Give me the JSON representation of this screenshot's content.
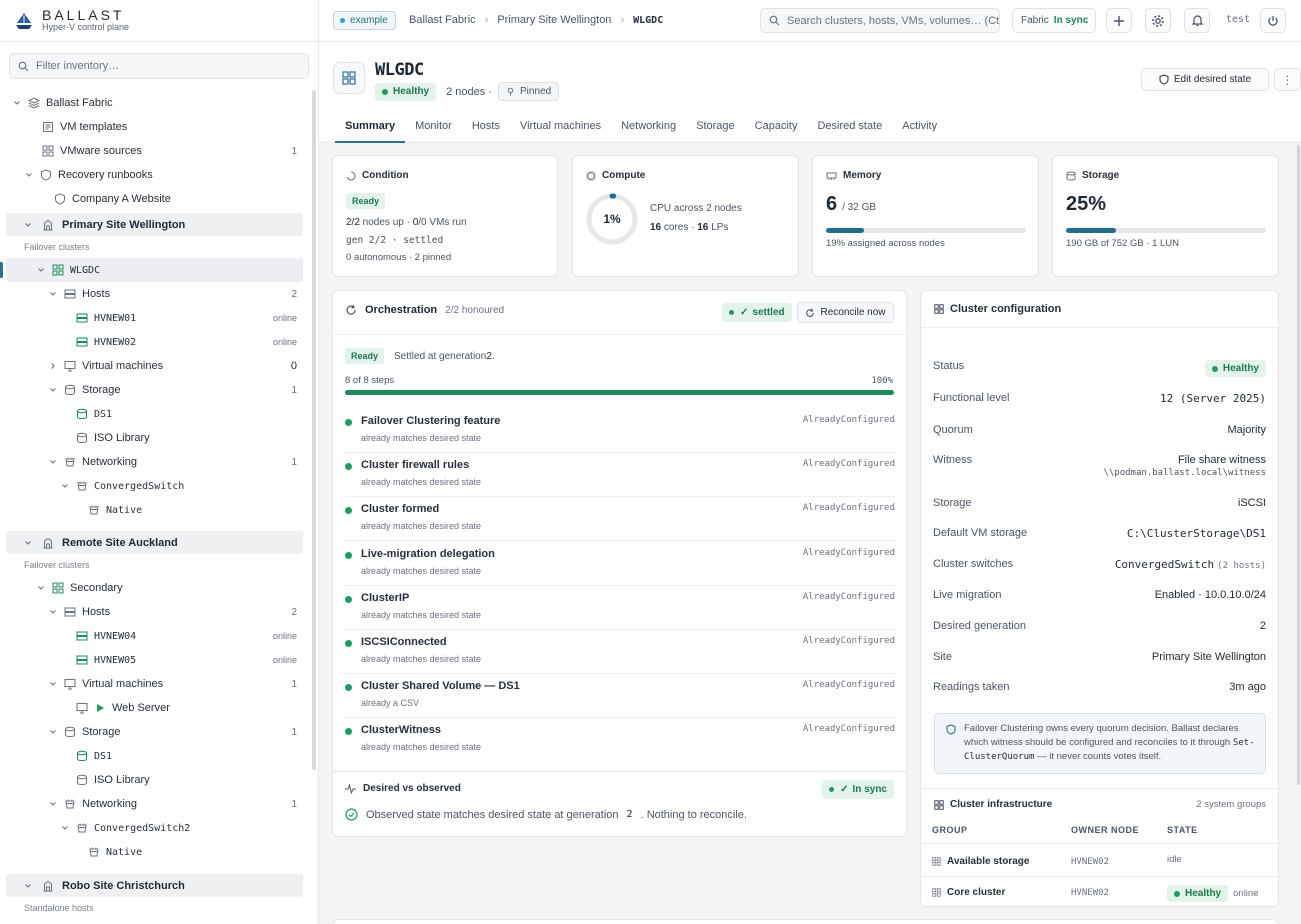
{
  "brand": {
    "name": "BALLAST",
    "subtitle": "Hyper-V control plane"
  },
  "sidebar": {
    "filter_placeholder": "Filter inventory…",
    "tree": {
      "fabric": "Ballast Fabric",
      "vm_templates": "VM templates",
      "vmware_sources": "VMware sources",
      "vmware_sources_count": "1",
      "recovery_runbooks": "Recovery runbooks",
      "company_site": "Company A Website"
    },
    "sites": [
      {
        "name": "Primary Site Wellington",
        "group_label": "Failover clusters",
        "cluster": "WLGDC",
        "hosts_label": "Hosts",
        "hosts_count": "2",
        "hosts": [
          {
            "name": "HVNEW01",
            "status": "online"
          },
          {
            "name": "HVNEW02",
            "status": "online"
          }
        ],
        "vms_label": "Virtual machines",
        "vms_count": "0",
        "storage_label": "Storage",
        "storage_count": "1",
        "storage": [
          "DS1",
          "ISO Library"
        ],
        "networking_label": "Networking",
        "networking_count": "1",
        "switch": "ConvergedSwitch",
        "native": "Native"
      },
      {
        "name": "Remote Site Auckland",
        "group_label": "Failover clusters",
        "cluster": "Secondary",
        "hosts_label": "Hosts",
        "hosts_count": "2",
        "hosts": [
          {
            "name": "HVNEW04",
            "status": "online"
          },
          {
            "name": "HVNEW05",
            "status": "online"
          }
        ],
        "vms_label": "Virtual machines",
        "vms_count": "1",
        "vm": "Web Server",
        "storage_label": "Storage",
        "storage_count": "1",
        "storage": [
          "DS1",
          "ISO Library"
        ],
        "networking_label": "Networking",
        "networking_count": "1",
        "switch": "ConvergedSwitch2",
        "native": "Native"
      },
      {
        "name": "Robo Site Christchurch",
        "group_label": "Standalone hosts"
      }
    ]
  },
  "topbar": {
    "env_badge": "example",
    "breadcrumbs": [
      "Ballast Fabric",
      "Primary Site Wellington",
      "WLGDC"
    ],
    "search_placeholder": "Search clusters, hosts, VMs, volumes… (Ctrl-K)",
    "fabric_label": "Fabric",
    "fabric_status": "In sync",
    "user": "test"
  },
  "header": {
    "title": "WLGDC",
    "health": "Healthy",
    "nodes": "2 nodes ·",
    "pinned": "Pinned",
    "edit_button": "Edit desired state",
    "tabs": [
      "Summary",
      "Monitor",
      "Hosts",
      "Virtual machines",
      "Networking",
      "Storage",
      "Capacity",
      "Desired state",
      "Activity"
    ]
  },
  "condition": {
    "title": "Condition",
    "status": "Ready",
    "nodes_up_a": "2/2",
    "nodes_up_b": " nodes up · ",
    "vms_a": "0",
    "vms_b": "/0 VMs run",
    "gen": "gen 2/2 · settled",
    "footer": "0 autonomous · 2 pinned"
  },
  "compute": {
    "title": "Compute",
    "percent": "1%",
    "percent_value": 1,
    "line1": "CPU across 2 nodes",
    "cores": "16",
    "cores_label": " cores · ",
    "lps": "16",
    "lps_label": " LPs"
  },
  "memory": {
    "title": "Memory",
    "value": "6",
    "total": "/ 32 GB",
    "fill_percent": 19,
    "caption": "19% assigned across nodes"
  },
  "storage": {
    "title": "Storage",
    "value": "25%",
    "fill_percent": 25,
    "caption": "190 GB of 752 GB · 1 LUN"
  },
  "orchestration": {
    "title": "Orchestration",
    "honoured": "2/2 honoured",
    "settled": "settled",
    "reconcile_button": "Reconcile now",
    "ready": "Ready",
    "settled_text_a": "Settled at generation ",
    "settled_text_b": "2",
    "settled_text_c": ".",
    "steps_label": "8 of 8 steps",
    "progress_label": "100%",
    "progress_percent": 100,
    "steps": [
      {
        "name": "Failover Clustering feature",
        "desc": "already matches desired state",
        "status": "AlreadyConfigured"
      },
      {
        "name": "Cluster firewall rules",
        "desc": "already matches desired state",
        "status": "AlreadyConfigured"
      },
      {
        "name": "Cluster formed",
        "desc": "already matches desired state",
        "status": "AlreadyConfigured"
      },
      {
        "name": "Live-migration delegation",
        "desc": "already matches desired state",
        "status": "AlreadyConfigured"
      },
      {
        "name": "ClusterIP",
        "desc": "already matches desired state",
        "status": "AlreadyConfigured"
      },
      {
        "name": "ISCSIConnected",
        "desc": "already matches desired state",
        "status": "AlreadyConfigured"
      },
      {
        "name": "Cluster Shared Volume — DS1",
        "desc": "already a CSV",
        "status": "AlreadyConfigured"
      },
      {
        "name": "ClusterWitness",
        "desc": "already matches desired state",
        "status": "AlreadyConfigured"
      }
    ]
  },
  "desired_vs_observed": {
    "title": "Desired vs observed",
    "status": "In sync",
    "text_a": "Observed state matches desired state at generation",
    "generation": "2",
    "text_b": ". Nothing to reconcile."
  },
  "cluster_config": {
    "title": "Cluster configuration",
    "status_label": "Status",
    "status_value": "Healthy",
    "rows": [
      {
        "label": "Functional level",
        "value": "12 (Server 2025)"
      },
      {
        "label": "Quorum",
        "value": "Majority"
      },
      {
        "label": "Witness",
        "value": "File share witness",
        "sub": "\\\\podman.ballast.local\\witness"
      },
      {
        "label": "Storage",
        "value": "iSCSI"
      },
      {
        "label": "Default VM storage",
        "value": "C:\\ClusterStorage\\DS1"
      },
      {
        "label": "Cluster switches",
        "value": "ConvergedSwitch",
        "extra": "(2 hosts)"
      },
      {
        "label": "Live migration",
        "value": "Enabled · 10.0.10.0/24"
      },
      {
        "label": "Desired generation",
        "value": "2"
      },
      {
        "label": "Site",
        "value": "Primary Site Wellington"
      },
      {
        "label": "Readings taken",
        "value": "3m ago"
      }
    ],
    "note_a": "Failover Clustering owns every quorum decision. Ballast declares which witness should be configured and reconciles to it through ",
    "note_code": "Set-ClusterQuorum",
    "note_b": " — it never counts votes itself."
  },
  "cluster_infra": {
    "title": "Cluster infrastructure",
    "count": "2 system groups",
    "columns": [
      "GROUP",
      "OWNER NODE",
      "STATE"
    ],
    "rows": [
      {
        "group": "Available storage",
        "owner": "HVNEW02",
        "state": "idle"
      },
      {
        "group": "Core cluster",
        "owner": "HVNEW02",
        "state": "Healthy",
        "state_extra": "online"
      }
    ]
  },
  "colors": {
    "accent": "#2f6f8f",
    "healthy": "#1f9a60",
    "bar": "#1f6f8b"
  }
}
